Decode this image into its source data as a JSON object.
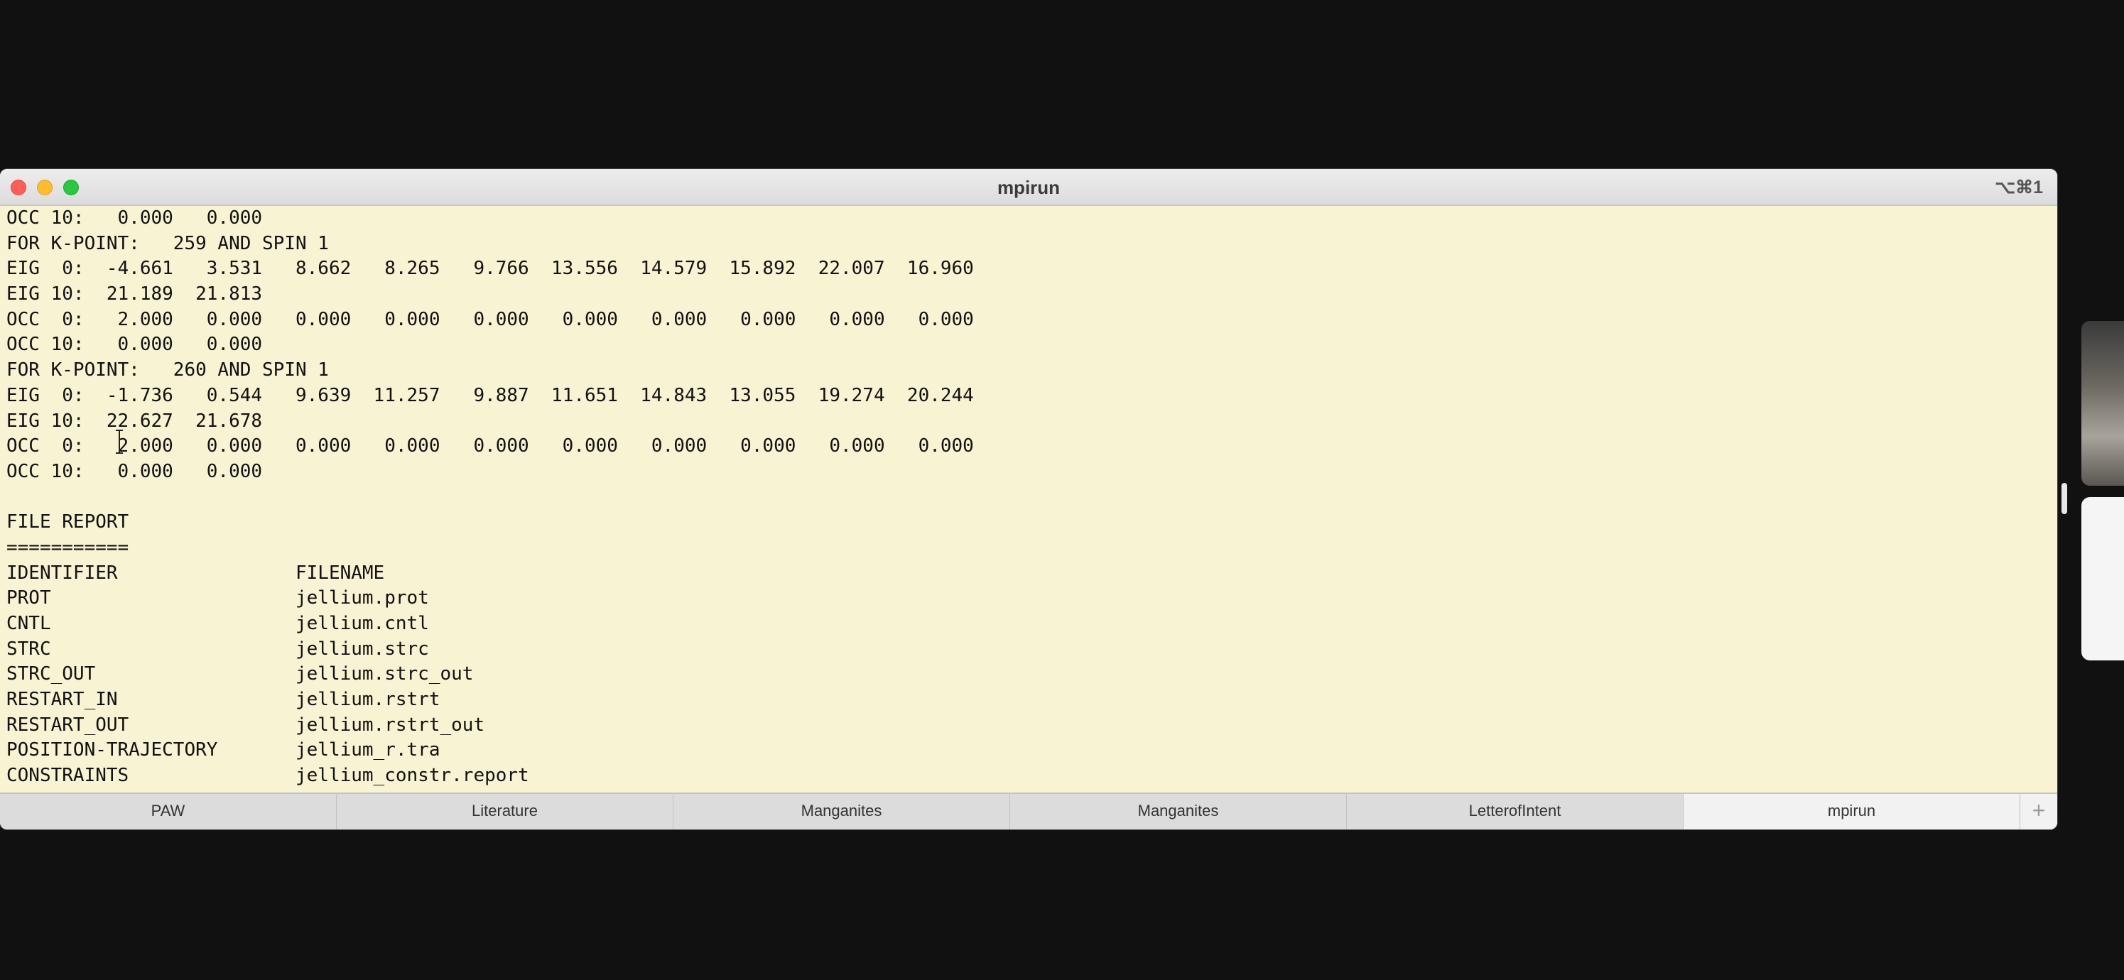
{
  "window": {
    "title": "mpirun",
    "shortcut": "⌥⌘1",
    "accent_colors": {
      "close": "#fe5f57",
      "minimize": "#febc2e",
      "zoom": "#28c840",
      "terminal_background": "#f8f3d2"
    }
  },
  "terminal": {
    "lines": [
      "OCC 10:   0.000   0.000",
      "FOR K-POINT:   259 AND SPIN 1",
      "EIG  0:  -4.661   3.531   8.662   8.265   9.766  13.556  14.579  15.892  22.007  16.960",
      "EIG 10:  21.189  21.813",
      "OCC  0:   2.000   0.000   0.000   0.000   0.000   0.000   0.000   0.000   0.000   0.000",
      "OCC 10:   0.000   0.000",
      "FOR K-POINT:   260 AND SPIN 1",
      "EIG  0:  -1.736   0.544   9.639  11.257   9.887  11.651  14.843  13.055  19.274  20.244",
      "EIG 10:  22.627  21.678",
      "OCC  0:   2.000   0.000   0.000   0.000   0.000   0.000   0.000   0.000   0.000   0.000",
      "OCC 10:   0.000   0.000",
      "",
      "FILE REPORT",
      "===========",
      "IDENTIFIER                FILENAME",
      "PROT                      jellium.prot",
      "CNTL                      jellium.cntl",
      "STRC                      jellium.strc",
      "STRC_OUT                  jellium.strc_out",
      "RESTART_IN                jellium.rstrt",
      "RESTART_OUT               jellium.rstrt_out",
      "POSITION-TRAJECTORY       jellium_r.tra",
      "CONSTRAINTS               jellium_constr.report"
    ]
  },
  "tabs": [
    {
      "label": "PAW",
      "active": false
    },
    {
      "label": "Literature",
      "active": false
    },
    {
      "label": "Manganites",
      "active": false
    },
    {
      "label": "Manganites",
      "active": false
    },
    {
      "label": "LetterofIntent",
      "active": false
    },
    {
      "label": "mpirun",
      "active": true
    }
  ],
  "tab_add_icon": "+",
  "icons": {
    "close": "close-icon",
    "minimize": "minimize-icon",
    "zoom": "zoom-icon",
    "cursor": "text-cursor-icon",
    "add_tab": "plus-icon"
  }
}
